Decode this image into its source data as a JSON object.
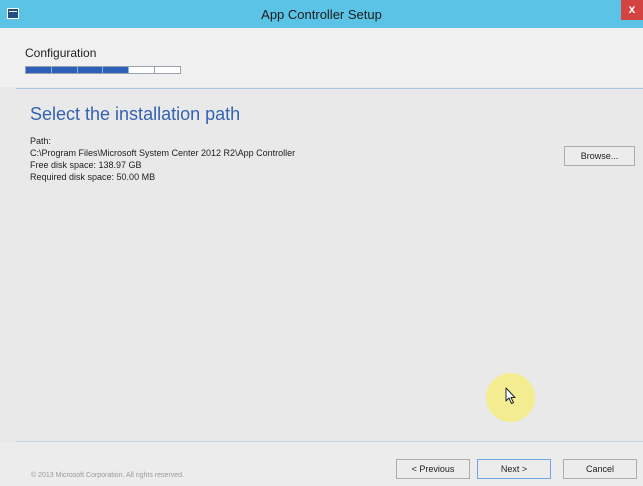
{
  "window": {
    "title": "App Controller Setup",
    "close_glyph": "x"
  },
  "header": {
    "stage_label": "Configuration",
    "progress": {
      "segments_total": 6,
      "segments_completed": 4,
      "color": "#2d5fb9"
    }
  },
  "page": {
    "heading": "Select the installation path",
    "path_label": "Path:",
    "path_value": "C:\\Program Files\\Microsoft System Center 2012 R2\\App Controller",
    "free_disk_space": "Free disk space: 138.97 GB",
    "required_disk_space": "Required disk space: 50.00 MB",
    "browse_label": "Browse..."
  },
  "footer": {
    "copyright": "© 2013 Microsoft Corporation. All rights reserved.",
    "previous_label": "< Previous",
    "next_label": "Next >",
    "cancel_label": "Cancel"
  },
  "colors": {
    "titlebar": "#5bc4e6",
    "close": "#d24341",
    "heading": "#3363b2"
  },
  "icons": {
    "app": "app-window-icon",
    "close": "close-icon",
    "cursor": "mouse-cursor-icon"
  }
}
